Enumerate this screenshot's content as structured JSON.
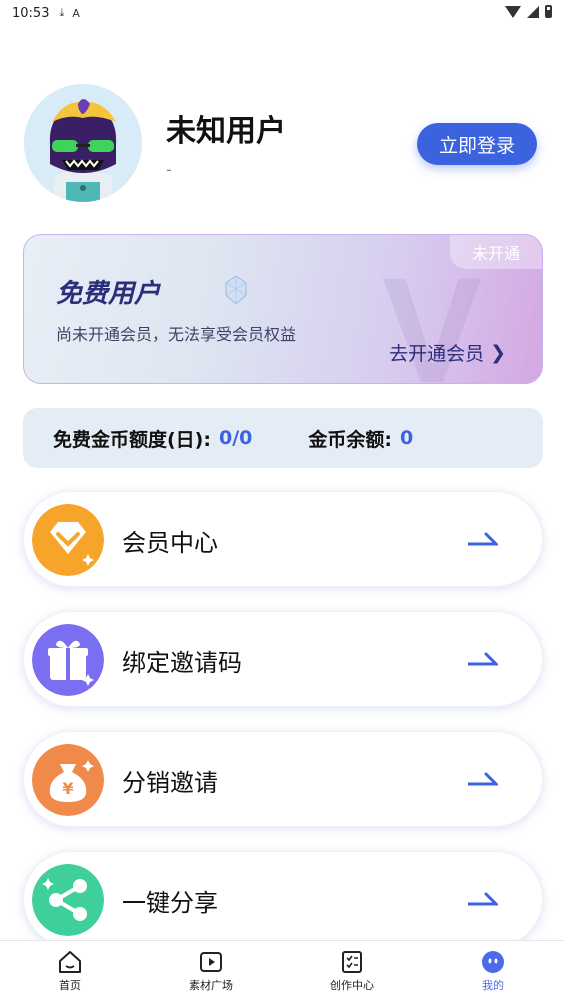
{
  "status_bar": {
    "time": "10:53",
    "download_icon": "download-icon",
    "a_icon": "A"
  },
  "profile": {
    "username": "未知用户",
    "subtitle": "-",
    "login_label": "立即登录"
  },
  "vip_card": {
    "status": "未开通",
    "title": "免费用户",
    "watermark": "V",
    "description": "尚未开通会员，无法享受会员权益",
    "link_label": "去开通会员",
    "link_arrow": "❯"
  },
  "coins": {
    "daily_label": "免费金币额度(日):",
    "daily_value": "0/0",
    "balance_label": "金币余额:",
    "balance_value": "0"
  },
  "menu": [
    {
      "label": "会员中心",
      "icon": "diamond-icon",
      "color": "#f7a52a"
    },
    {
      "label": "绑定邀请码",
      "icon": "gift-icon",
      "color": "#7a6ff0"
    },
    {
      "label": "分销邀请",
      "icon": "money-bag-icon",
      "color": "#f08a4b"
    },
    {
      "label": "一键分享",
      "icon": "share-icon",
      "color": "#3fcf9a"
    }
  ],
  "bottom_nav": [
    {
      "label": "首页",
      "icon": "home-icon"
    },
    {
      "label": "素材广场",
      "icon": "video-icon"
    },
    {
      "label": "创作中心",
      "icon": "checklist-icon"
    },
    {
      "label": "我的",
      "icon": "profile-face-icon",
      "active": true
    }
  ],
  "colors": {
    "accent": "#3b63e0",
    "nav_active": "#4b6be8"
  }
}
